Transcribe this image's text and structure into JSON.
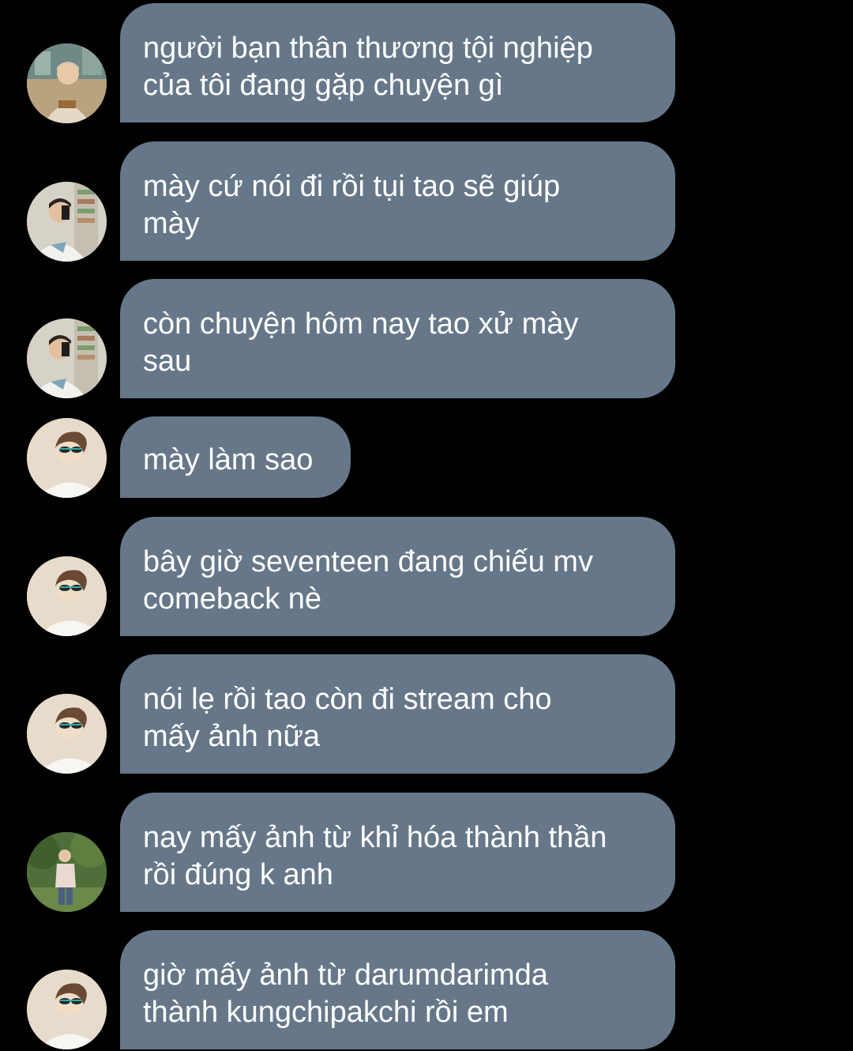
{
  "messages": [
    {
      "text": "người bạn thân thương tội nghiệp\ncủa tôi đang gặp chuyện gì",
      "avatar": "avatar-cafe-icon"
    },
    {
      "text": "mày cứ nói đi rồi tụi tao sẽ giúp\nmày",
      "avatar": "avatar-mirror-selfie-icon"
    },
    {
      "text": "còn chuyện hôm nay tao xử mày\nsau",
      "avatar": "avatar-mirror-selfie-icon"
    },
    {
      "text": "mày làm sao",
      "avatar": "avatar-sunglasses-icon"
    },
    {
      "text": "bây giờ seventeen đang chiếu mv\ncomeback nè",
      "avatar": "avatar-sunglasses-icon"
    },
    {
      "text": "nói lẹ rồi tao còn đi stream cho\nmấy ảnh nữa",
      "avatar": "avatar-sunglasses-icon"
    },
    {
      "text": "nay mấy ảnh từ khỉ hóa thành thần\nrồi đúng k anh",
      "avatar": "avatar-park-icon"
    },
    {
      "text": "giờ mấy ảnh từ darumdarimda\nthành kungchipakchi rồi em",
      "avatar": "avatar-sunglasses-icon"
    }
  ],
  "colors": {
    "background": "#000000",
    "bubble": "#667789",
    "text": "#ffffff"
  }
}
